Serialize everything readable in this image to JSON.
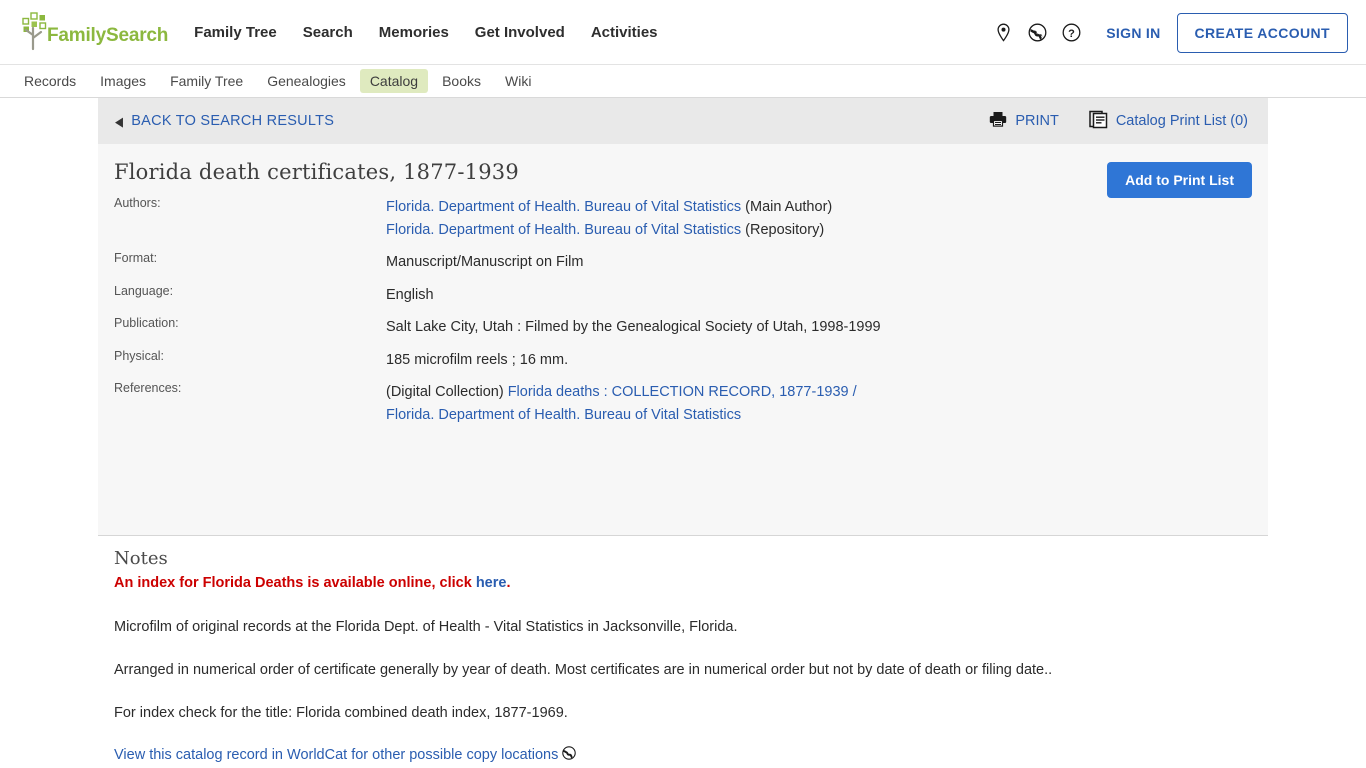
{
  "header": {
    "brand": "FamilySearch",
    "nav": [
      {
        "label": "Family Tree"
      },
      {
        "label": "Search"
      },
      {
        "label": "Memories"
      },
      {
        "label": "Get Involved"
      },
      {
        "label": "Activities"
      }
    ],
    "icons": [
      {
        "name": "location-pin-icon"
      },
      {
        "name": "globe-icon"
      },
      {
        "name": "help-circle-icon"
      }
    ],
    "sign_in": "SIGN IN",
    "create_account": "CREATE ACCOUNT"
  },
  "subnav": {
    "items": [
      {
        "label": "Records",
        "active": false
      },
      {
        "label": "Images",
        "active": false
      },
      {
        "label": "Family Tree",
        "active": false
      },
      {
        "label": "Genealogies",
        "active": false
      },
      {
        "label": "Catalog",
        "active": true
      },
      {
        "label": "Books",
        "active": false
      },
      {
        "label": "Wiki",
        "active": false
      }
    ],
    "active_label": "Catalog"
  },
  "backbar": {
    "back_label": "BACK TO SEARCH RESULTS",
    "print_label": "PRINT",
    "catalog_print_list_label": "Catalog Print List (0)"
  },
  "record": {
    "title": "Florida death certificates, 1877-1939",
    "add_to_print_list": "Add to Print List",
    "fields": [
      {
        "label": "Authors:",
        "lines": [
          {
            "link": "Florida. Department of Health. Bureau of Vital Statistics",
            "suffix": " (Main Author)"
          },
          {
            "link": "Florida. Department of Health. Bureau of Vital Statistics",
            "suffix": " (Repository)"
          }
        ]
      },
      {
        "label": "Format:",
        "text": "Manuscript/Manuscript on Film"
      },
      {
        "label": "Language:",
        "text": "English"
      },
      {
        "label": "Publication:",
        "text": "Salt Lake City, Utah : Filmed by the Genealogical Society of Utah, 1998-1999"
      },
      {
        "label": "Physical:",
        "text": "185 microfilm reels ; 16 mm."
      },
      {
        "label": "References:",
        "prefix": "(Digital Collection) ",
        "link": "Florida deaths : COLLECTION RECORD, 1877-1939 / Florida. Department of Health. Bureau of Vital Statistics"
      }
    ]
  },
  "notes": {
    "heading": "Notes",
    "alert_text": "An index for Florida Deaths is available online, click ",
    "alert_link": "here",
    "alert_period": ".",
    "paragraphs": [
      "Microfilm of original records at the Florida Dept. of Health - Vital Statistics in Jacksonville, Florida.",
      "Arranged in numerical order of certificate generally by year of death. Most certificates are in numerical order but not by date of death or filing date..",
      "For index check for the title: Florida combined death index, 1877-1969."
    ],
    "worldcat_link": "View this catalog record in WorldCat for other possible copy locations"
  },
  "colors": {
    "brand_green": "#8cb83f",
    "link_blue": "#2a5db0",
    "button_blue": "#2f76d6",
    "alert_red": "#cc0000",
    "panel_gray": "#f7f7f7",
    "backbar_gray": "#e9e9e9",
    "active_tab_green": "#dfeabf"
  }
}
